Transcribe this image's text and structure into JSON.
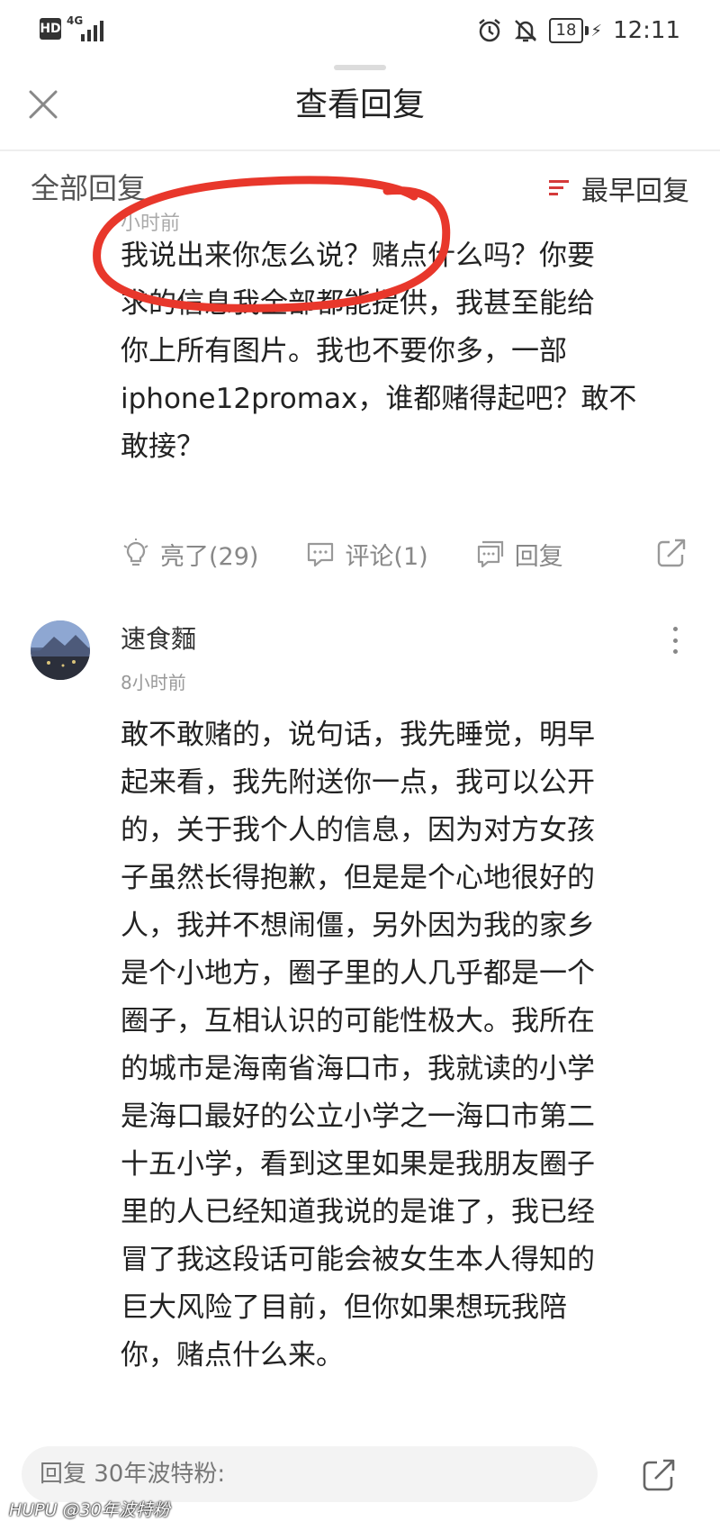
{
  "status_bar": {
    "hd": "HD",
    "network": "4G",
    "battery": "18",
    "time": "12:11",
    "icons": [
      "alarm-icon",
      "mute-icon",
      "charging-icon"
    ]
  },
  "header": {
    "title": "查看回复",
    "close_icon": "close-icon"
  },
  "section": {
    "label": "全部回复",
    "sort_label": "最早回复",
    "sort_icon": "sort-icon",
    "accent_color": "#d43a3a"
  },
  "first_reply": {
    "time_partial": "小时前",
    "text": "我说出来你怎么说？赌点什么吗？你要求的信息我全部都能提供，我甚至能给你上所有图片。我也不要你多，一部iphone12promax，谁都赌得起吧？敢不敢接？",
    "lines": [
      "我说出来你怎么说？赌点什么吗？你要",
      "求的信息我全部都能提供，我甚至能给",
      "你上所有图片。我也不要你多，一部",
      "iphone12promax，谁都赌得起吧？敢不",
      "敢接？"
    ],
    "actions": {
      "like": "亮了(29)",
      "comment": "评论(1)",
      "reply": "回复"
    }
  },
  "second_reply": {
    "username": "速食麵",
    "time": "8小时前",
    "lines": [
      "敢不敢赌的，说句话，我先睡觉，明早",
      "起来看，我先附送你一点，我可以公开",
      "的，关于我个人的信息，因为对方女孩",
      "子虽然长得抱歉，但是是个心地很好的",
      "人，我并不想闹僵，另外因为我的家乡",
      "是个小地方，圈子里的人几乎都是一个",
      "圈子，互相认识的可能性极大。我所在",
      "的城市是海南省海口市，我就读的小学",
      "是海口最好的公立小学之一海口市第二",
      "十五小学，看到这里如果是我朋友圈子",
      "里的人已经知道我说的是谁了，我已经",
      "冒了我这段话可能会被女生本人得知的",
      "巨大风险了目前，但你如果想玩我陪",
      "你，赌点什么来。"
    ]
  },
  "bottom_bar": {
    "placeholder": "回复 30年波特粉:",
    "watermark": "HUPU @30年波特粉"
  },
  "annotation_color": "#e8372b"
}
